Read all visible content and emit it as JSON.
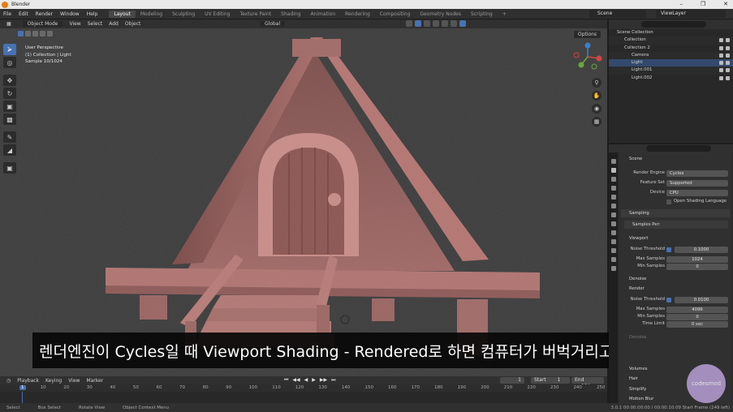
{
  "window": {
    "title": "Blender"
  },
  "top_menu": [
    "File",
    "Edit",
    "Render",
    "Window",
    "Help"
  ],
  "workspace_tabs": [
    "Layout",
    "Modeling",
    "Sculpting",
    "UV Editing",
    "Texture Paint",
    "Shading",
    "Animation",
    "Rendering",
    "Compositing",
    "Geometry Nodes",
    "Scripting",
    "+"
  ],
  "scene_field": "Scene",
  "view_layer_field": "ViewLayer",
  "viewport_header": {
    "mode": "Object Mode",
    "menus": [
      "View",
      "Select",
      "Add",
      "Object"
    ],
    "orientation": "Global",
    "options": "Options"
  },
  "viewport_info": {
    "line1": "User Perspective",
    "line2": "(1) Collection | Light",
    "line3": "Sample 10/1024"
  },
  "subtitle": "렌더엔진이 Cycles일 때 Viewport Shading - Rendered로 하면 컴퓨터가 버벅거리고 화낼 수 있어요.",
  "outliner": {
    "rows": [
      {
        "label": "Scene Collection",
        "indent": 0,
        "eye": false
      },
      {
        "label": "Collection",
        "indent": 1,
        "eye": true
      },
      {
        "label": "Collection 2",
        "indent": 1,
        "eye": true
      },
      {
        "label": "Camera",
        "indent": 2,
        "eye": true
      },
      {
        "label": "Light",
        "indent": 2,
        "eye": true
      },
      {
        "label": "Light.001",
        "indent": 2,
        "eye": true
      },
      {
        "label": "Light.002",
        "indent": 2,
        "eye": true
      }
    ]
  },
  "properties": {
    "scene_name": "Scene",
    "render_engine_label": "Render Engine",
    "render_engine": "Cycles",
    "feature_set_label": "Feature Set",
    "feature_set": "Supported",
    "device_label": "Device",
    "device": "CPU",
    "osl_label": "Open Shading Language",
    "sampling": "Sampling",
    "samples_per": "Samples Per:",
    "viewport": "Viewport",
    "vp_noise_label": "Noise Threshold",
    "vp_noise": "0.1000",
    "vp_max_label": "Max Samples",
    "vp_max": "1024",
    "vp_min_label": "Min Samples",
    "vp_min": "0",
    "denoise": "Denoise",
    "render": "Render",
    "r_noise_label": "Noise Threshold",
    "r_noise": "0.0100",
    "r_max_label": "Max Samples",
    "r_max": "4096",
    "r_min_label": "Min Samples",
    "r_min": "0",
    "r_time_label": "Time Limit",
    "r_time": "0 sec",
    "r_denoise": "Denoise",
    "volumes": "Volumes",
    "hair": "Hair",
    "simplify": "Simplify",
    "motion_blur": "Motion Blur"
  },
  "timeline": {
    "menus": [
      "Playback",
      "Keying",
      "View",
      "Marker"
    ],
    "current_frame": "1",
    "start_label": "Start",
    "start": "1",
    "end_label": "End",
    "end": "250",
    "ticks": [
      "1",
      "10",
      "20",
      "30",
      "40",
      "50",
      "60",
      "70",
      "80",
      "90",
      "100",
      "110",
      "120",
      "130",
      "140",
      "150",
      "160",
      "170",
      "180",
      "190",
      "200",
      "210",
      "220",
      "230",
      "240",
      "250"
    ]
  },
  "statusbar": {
    "select": "Select",
    "box_select": "Box Select",
    "rotate_view": "Rotate View",
    "context_menu": "Object Context Menu",
    "version": "3.0.1 00:00:00:00 / 00:00:10:09 Start Frame (249 left)"
  },
  "watermark": "codesmod",
  "colors": {
    "accent": "#4772b3",
    "house": "#b27370",
    "viewport_bg": "#393939"
  }
}
